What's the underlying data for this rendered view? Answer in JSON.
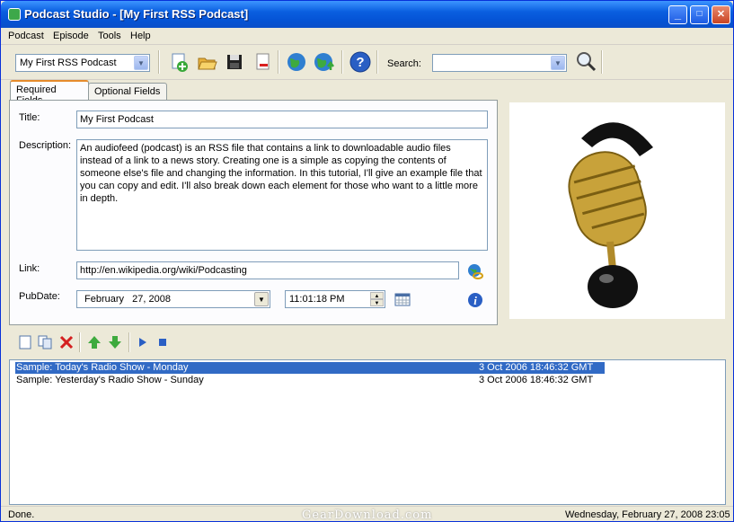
{
  "window": {
    "title": "Podcast Studio - [My First RSS Podcast]",
    "minimize": "_",
    "maximize": "□",
    "close": "✕"
  },
  "menu": [
    "Podcast",
    "Episode",
    "Tools",
    "Help"
  ],
  "toolbar": {
    "podcast_select": "My First RSS Podcast",
    "search_label": "Search:",
    "search_value": "",
    "icons": [
      "new-icon",
      "open-folder-icon",
      "save-disk-icon",
      "delete-doc-icon",
      "globe-icon",
      "globe-upload-icon",
      "help-icon",
      "magnifier-icon"
    ]
  },
  "tabs": [
    "Required Fields",
    "Optional Fields"
  ],
  "form": {
    "title_label": "Title:",
    "title_value": "My First Podcast",
    "description_label": "Description:",
    "description_value": "An audiofeed (podcast) is an RSS file that contains a link to downloadable audio files instead of a link to a news story. Creating one is a simple as copying the contents of someone else's file and changing the information. In this tutorial, I'll give an example file that you can copy and edit. I'll also break down each element for those who want to a little more in depth.",
    "link_label": "Link:",
    "link_value": "http://en.wikipedia.org/wiki/Podcasting",
    "pubdate_label": "PubDate:",
    "date_value": "February   27, 2008",
    "time_value": "11:01:18 PM"
  },
  "episodes": [
    {
      "title": "Sample: Today's Radio Show - Monday",
      "date": "3 Oct 2006 18:46:32 GMT",
      "selected": true
    },
    {
      "title": "Sample: Yesterday's Radio Show - Sunday",
      "date": "3 Oct 2006 18:46:32 GMT",
      "selected": false
    }
  ],
  "status": {
    "left": "Done.",
    "right": "Wednesday, February 27, 2008 23:05"
  },
  "watermark": "GearDownload.com",
  "colors": {
    "selection": "#316ac5",
    "titlebar": "#0a5fe0",
    "face": "#ece9d8"
  }
}
